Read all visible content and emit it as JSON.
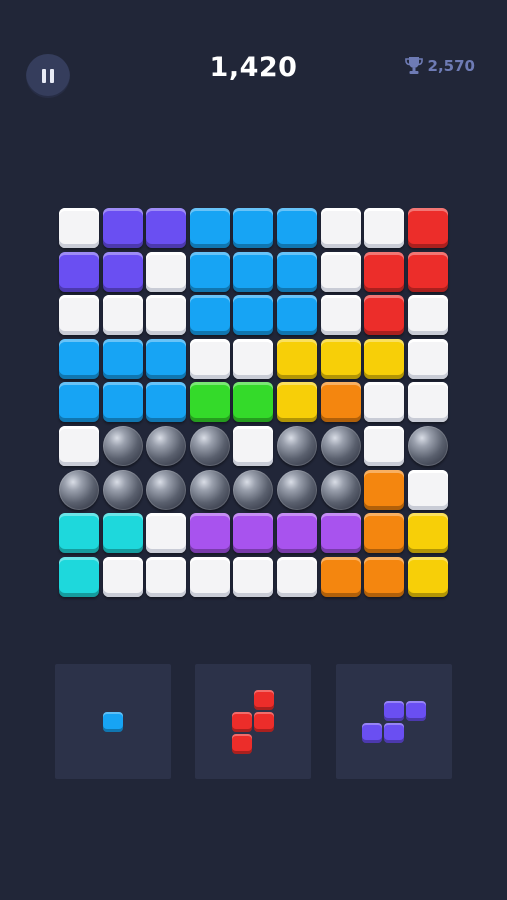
{
  "header": {
    "score": "1,420",
    "best_score": "2,570",
    "pause_icon": "pause-icon",
    "trophy_icon": "trophy-icon"
  },
  "colors": {
    "background": "#212638",
    "white": "#f4f4f6",
    "purple": "#6a4ff2",
    "blue": "#17a4f4",
    "red": "#ec2d2a",
    "yellow": "#f7cf08",
    "orange": "#f4860f",
    "green": "#34da2a",
    "violet": "#a853ee",
    "cyan": "#1ed8dc",
    "bubble": "#5a606e"
  },
  "board": {
    "rows": [
      [
        "white",
        "purple",
        "purple",
        "blue",
        "blue",
        "blue",
        "white",
        "white",
        "red"
      ],
      [
        "purple",
        "purple",
        "white",
        "blue",
        "blue",
        "blue",
        "white",
        "red",
        "red"
      ],
      [
        "white",
        "white",
        "white",
        "blue",
        "blue",
        "blue",
        "white",
        "red",
        "white"
      ],
      [
        "blue",
        "blue",
        "blue",
        "white",
        "white",
        "yellow",
        "yellow",
        "yellow",
        "white"
      ],
      [
        "blue",
        "blue",
        "blue",
        "green",
        "green",
        "yellow",
        "orange",
        "white",
        "white"
      ],
      [
        "white",
        "bubble",
        "bubble",
        "bubble",
        "white",
        "bubble",
        "bubble",
        "white",
        "bubble"
      ],
      [
        "bubble",
        "bubble",
        "bubble",
        "bubble",
        "bubble",
        "bubble",
        "bubble",
        "orange",
        "white"
      ],
      [
        "cyan",
        "cyan",
        "white",
        "violet",
        "violet",
        "violet",
        "violet",
        "orange",
        "yellow"
      ],
      [
        "cyan",
        "white",
        "white",
        "white",
        "white",
        "white",
        "orange",
        "orange",
        "yellow"
      ]
    ]
  },
  "pieces": [
    {
      "name": "piece-single-blue",
      "color": "blue",
      "cells": [
        [
          0,
          0
        ]
      ]
    },
    {
      "name": "piece-s-red",
      "color": "red",
      "cells": [
        [
          1,
          0
        ],
        [
          0,
          1
        ],
        [
          1,
          1
        ],
        [
          0,
          2
        ]
      ]
    },
    {
      "name": "piece-s-purple",
      "color": "purple",
      "cells": [
        [
          1,
          0
        ],
        [
          2,
          0
        ],
        [
          0,
          1
        ],
        [
          1,
          1
        ]
      ]
    }
  ]
}
